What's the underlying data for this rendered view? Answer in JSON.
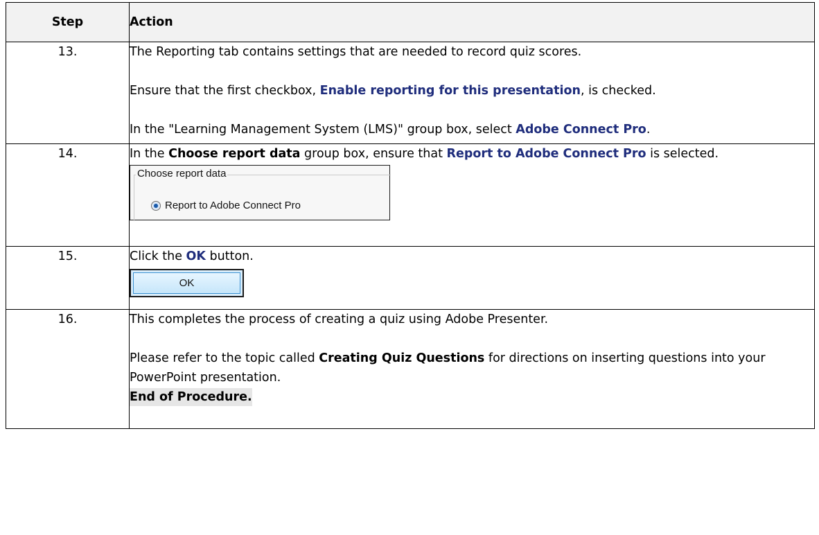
{
  "table": {
    "header_step": "Step",
    "header_action": "Action"
  },
  "rows": [
    {
      "num": "13.",
      "p1": "The Reporting tab contains settings that are needed to record quiz scores.",
      "p2_pre": "Ensure that the first checkbox, ",
      "p2_kw": "Enable reporting for this presentation",
      "p2_post": ", is checked.",
      "p3_pre": "In the \"Learning Management System (LMS)\" group box, select ",
      "p3_kw": "Adobe Connect Pro",
      "p3_post": "."
    },
    {
      "num": "14.",
      "p1_pre": "In the ",
      "p1_b": "Choose report data",
      "p1_mid": " group box, ensure that ",
      "p1_kw": "Report to Adobe Connect Pro",
      "p1_post": " is selected.",
      "snippet_legend": "Choose report data",
      "snippet_radio": "Report to Adobe Connect Pro"
    },
    {
      "num": "15.",
      "p1_pre": "Click the ",
      "p1_kw": "OK",
      "p1_post": " button.",
      "button_label": "OK"
    },
    {
      "num": "16.",
      "p1": "This completes the process of creating a quiz using Adobe Presenter.",
      "p2_pre": "Please refer to the topic called ",
      "p2_b": "Creating Quiz Questions",
      "p2_post": " for directions on inserting questions into your PowerPoint presentation.",
      "end": "End of Procedure."
    }
  ],
  "colors": {
    "keyword": "#1f2d7c",
    "header_bg": "#f2f2f2",
    "ok_button_bg": "#d9eefc"
  }
}
